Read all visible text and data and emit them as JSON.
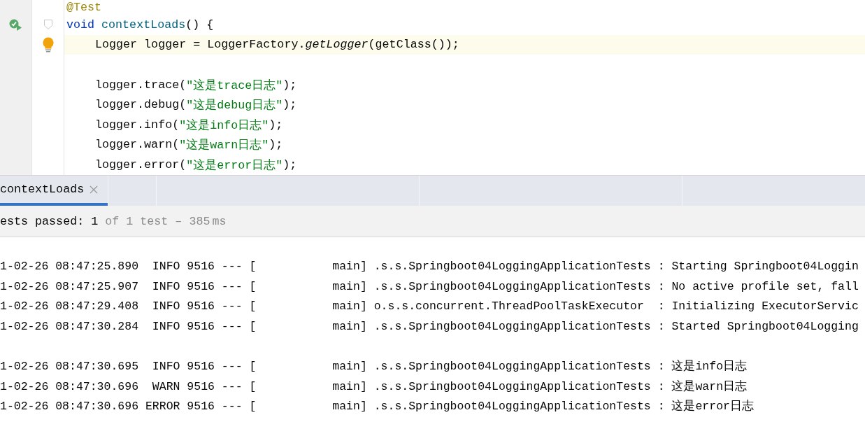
{
  "editor": {
    "annotation": "@Test",
    "method": {
      "segments": [
        {
          "kind": "keyword",
          "text": "void"
        },
        {
          "kind": "declaration",
          "text": "contextLoads"
        },
        {
          "kind": "plain",
          "text": "() {"
        }
      ],
      "runnable": true,
      "body": [
        {
          "current": true,
          "hint": true,
          "segments": [
            {
              "kind": "plain",
              "text": "Logger logger = LoggerFactory."
            },
            {
              "kind": "static",
              "text": "getLogger"
            },
            {
              "kind": "plain",
              "text": "(getClass());"
            }
          ]
        },
        {
          "current": false,
          "hint": false
        },
        {
          "current": false,
          "hint": false,
          "segments": [
            {
              "kind": "plain",
              "text": "logger.trace("
            },
            {
              "kind": "string",
              "text": "\"这是trace日志\""
            },
            {
              "kind": "plain",
              "text": ");"
            }
          ]
        },
        {
          "current": false,
          "hint": false,
          "segments": [
            {
              "kind": "plain",
              "text": "logger.debug("
            },
            {
              "kind": "string",
              "text": "\"这是debug日志\""
            },
            {
              "kind": "plain",
              "text": ");"
            }
          ]
        },
        {
          "current": false,
          "hint": false,
          "segments": [
            {
              "kind": "plain",
              "text": "logger.info("
            },
            {
              "kind": "string",
              "text": "\"这是info日志\""
            },
            {
              "kind": "plain",
              "text": ");"
            }
          ]
        },
        {
          "current": false,
          "hint": false,
          "segments": [
            {
              "kind": "plain",
              "text": "logger.warn("
            },
            {
              "kind": "string",
              "text": "\"这是warn日志\""
            },
            {
              "kind": "plain",
              "text": ");"
            }
          ]
        },
        {
          "current": false,
          "hint": false,
          "segments": [
            {
              "kind": "plain",
              "text": "logger.error("
            },
            {
              "kind": "string",
              "text": "\"这是error日志\""
            },
            {
              "kind": "plain",
              "text": ");"
            }
          ]
        }
      ]
    }
  },
  "run_tabs": [
    {
      "label": "contextLoads",
      "selected": true,
      "closable": true
    }
  ],
  "status": {
    "passed": "ests passed: 1",
    "detail": "of 1 test – 385",
    "unit": "ms"
  },
  "console": {
    "groups": [
      [
        "1-02-26 08:47:25.890  INFO 9516 --- [           main] .s.s.Springboot04LoggingApplicationTests : Starting Springboot04Loggin",
        "1-02-26 08:47:25.907  INFO 9516 --- [           main] .s.s.Springboot04LoggingApplicationTests : No active profile set, fall",
        "1-02-26 08:47:29.408  INFO 9516 --- [           main] o.s.s.concurrent.ThreadPoolTaskExecutor  : Initializing ExecutorServic",
        "1-02-26 08:47:30.284  INFO 9516 --- [           main] .s.s.Springboot04LoggingApplicationTests : Started Springboot04Logging"
      ],
      [
        "1-02-26 08:47:30.695  INFO 9516 --- [           main] .s.s.Springboot04LoggingApplicationTests : 这是info日志",
        "1-02-26 08:47:30.696  WARN 9516 --- [           main] .s.s.Springboot04LoggingApplicationTests : 这是warn日志",
        "1-02-26 08:47:30.696 ERROR 9516 --- [           main] .s.s.Springboot04LoggingApplicationTests : 这是error日志"
      ]
    ]
  }
}
